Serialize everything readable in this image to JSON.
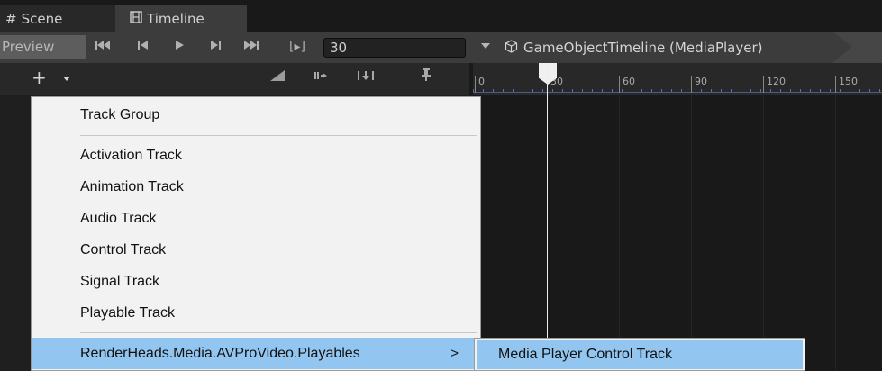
{
  "tabs": [
    {
      "label": "Scene",
      "icon": "grid-hash-icon",
      "active": false
    },
    {
      "label": "Timeline",
      "icon": "film-strip-icon",
      "active": true
    }
  ],
  "toolbar": {
    "preview_label": "Preview",
    "frame_value": "30",
    "asset_label": "GameObjectTimeline (MediaPlayer)",
    "icons": [
      "jump-to-start-icon",
      "previous-frame-icon",
      "play-icon",
      "next-frame-icon",
      "jump-to-end-icon",
      "play-range-icon"
    ]
  },
  "track_header": {
    "add_label": "+",
    "icons": [
      "clip-edit-mode-icon",
      "ripple-mode-icon",
      "replace-mode-icon",
      "pin-icon"
    ]
  },
  "ruler": {
    "labels": [
      "0",
      "30",
      "60",
      "90",
      "120",
      "150"
    ],
    "playhead_frame": 30
  },
  "menu": {
    "items": [
      {
        "label": "Track Group",
        "highlighted": false
      },
      {
        "label": "Activation Track",
        "highlighted": false
      },
      {
        "label": "Animation Track",
        "highlighted": false
      },
      {
        "label": "Audio Track",
        "highlighted": false
      },
      {
        "label": "Control Track",
        "highlighted": false
      },
      {
        "label": "Signal Track",
        "highlighted": false
      },
      {
        "label": "Playable Track",
        "highlighted": false
      },
      {
        "label": "RenderHeads.Media.AVProVideo.Playables",
        "highlighted": true,
        "submenu_arrow": ">"
      }
    ]
  },
  "submenu": {
    "items": [
      {
        "label": "Media Player Control Track",
        "highlighted": true
      }
    ]
  },
  "colors": {
    "menu_bg": "#f2f2f2",
    "menu_highlight": "#92c6f0",
    "editor_bg": "#191919",
    "toolbar_bg": "#3c3c3c",
    "ruler_accent": "#5670b0"
  }
}
